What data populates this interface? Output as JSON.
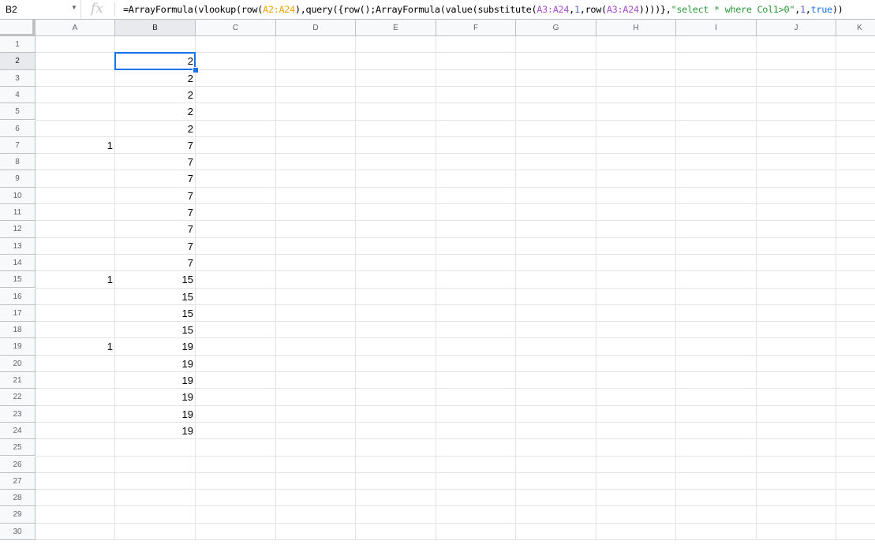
{
  "formula_bar": {
    "cell_ref": "B2",
    "fx_label": "fx",
    "formula_parts": [
      {
        "text": "=ArrayFormula(vlookup(row(",
        "color": "#000000"
      },
      {
        "text": "A2:A24",
        "color": "#f4a300"
      },
      {
        "text": "),query({row();ArrayFormula(value(substitute(",
        "color": "#000000"
      },
      {
        "text": "A3:A24",
        "color": "#a84ecf"
      },
      {
        "text": ",",
        "color": "#000000"
      },
      {
        "text": "1",
        "color": "#5c6bc0"
      },
      {
        "text": ",row(",
        "color": "#000000"
      },
      {
        "text": "A3:A24",
        "color": "#a84ecf"
      },
      {
        "text": "))))},",
        "color": "#000000"
      },
      {
        "text": "\"select * where Col1>0\"",
        "color": "#2e9b3f"
      },
      {
        "text": ",",
        "color": "#000000"
      },
      {
        "text": "1",
        "color": "#5c6bc0"
      },
      {
        "text": ",",
        "color": "#000000"
      },
      {
        "text": "true",
        "color": "#1a73e8"
      },
      {
        "text": "))",
        "color": "#000000"
      }
    ]
  },
  "columns": [
    "A",
    "B",
    "C",
    "D",
    "E",
    "F",
    "G",
    "H",
    "I",
    "J",
    "K"
  ],
  "selected_column": "B",
  "selected_row": 2,
  "row_count": 30,
  "cells": {
    "A": {
      "7": "1",
      "15": "1",
      "19": "1"
    },
    "B": {
      "2": "2",
      "3": "2",
      "4": "2",
      "5": "2",
      "6": "2",
      "7": "7",
      "8": "7",
      "9": "7",
      "10": "7",
      "11": "7",
      "12": "7",
      "13": "7",
      "14": "7",
      "15": "15",
      "16": "15",
      "17": "15",
      "18": "15",
      "19": "19",
      "20": "19",
      "21": "19",
      "22": "19",
      "23": "19",
      "24": "19"
    }
  }
}
